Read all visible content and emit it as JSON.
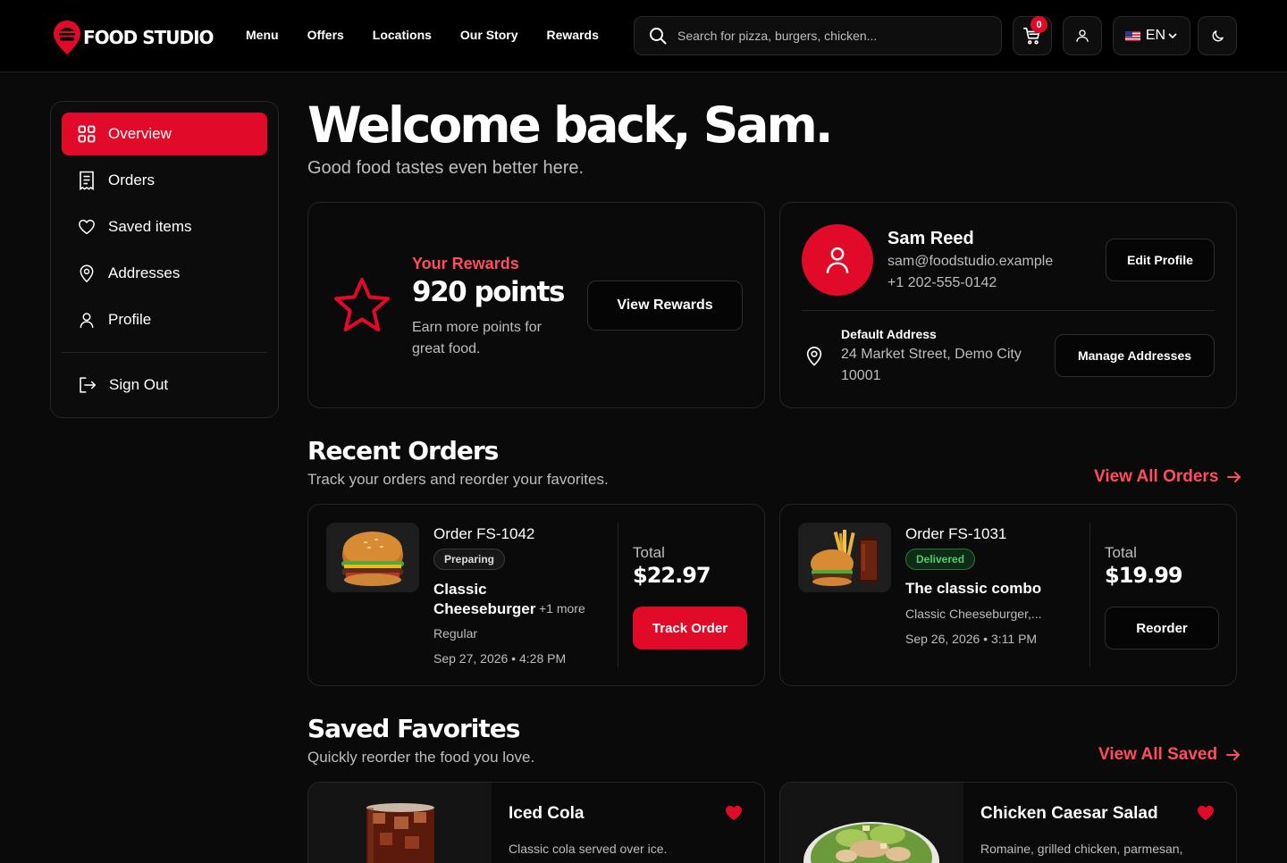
{
  "brand": {
    "name": "FOOD STUDIO",
    "accent": "#e10a28"
  },
  "nav": [
    "Menu",
    "Offers",
    "Locations",
    "Our Story",
    "Rewards"
  ],
  "search": {
    "placeholder": "Search for pizza, burgers, chicken..."
  },
  "cart": {
    "count": "0"
  },
  "language": {
    "code": "EN"
  },
  "sidebar": {
    "items": [
      {
        "label": "Overview",
        "icon": "grid-icon",
        "active": true
      },
      {
        "label": "Orders",
        "icon": "receipt-icon"
      },
      {
        "label": "Saved items",
        "icon": "heart-icon"
      },
      {
        "label": "Addresses",
        "icon": "location-pin-icon"
      },
      {
        "label": "Profile",
        "icon": "user-icon"
      }
    ],
    "signout": "Sign Out"
  },
  "welcome": {
    "title": "Welcome back, Sam.",
    "subtitle": "Good food tastes even better here."
  },
  "rewards": {
    "label": "Your Rewards",
    "points": "920 points",
    "desc": "Earn more points for great food.",
    "button": "View Rewards"
  },
  "profile": {
    "name": "Sam Reed",
    "email": "sam@foodstudio.example",
    "phone": "+1 202-555-0142",
    "edit_button": "Edit Profile",
    "address_label": "Default Address",
    "address": "24 Market Street, Demo City 10001",
    "manage_button": "Manage Addresses"
  },
  "recent_orders": {
    "title": "Recent Orders",
    "subtitle": "Track your orders and reorder your favorites.",
    "view_all": "View All Orders",
    "orders": [
      {
        "id": "Order FS-1042",
        "status": "Preparing",
        "item": "Classic Cheeseburger",
        "more": "+1 more",
        "variant": "Regular",
        "date": "Sep 27, 2026 • 4:28 PM",
        "total_label": "Total",
        "total": "$22.97",
        "action": "Track Order"
      },
      {
        "id": "Order FS-1031",
        "status": "Delivered",
        "item": "The classic combo",
        "details": "Classic Cheeseburger,...",
        "date": "Sep 26, 2026 • 3:11 PM",
        "total_label": "Total",
        "total": "$19.99",
        "action": "Reorder"
      }
    ]
  },
  "saved": {
    "title": "Saved Favorites",
    "subtitle": "Quickly reorder the food you love.",
    "view_all": "View All Saved",
    "items": [
      {
        "name": "Iced Cola",
        "desc": "Classic cola served over ice."
      },
      {
        "name": "Chicken Caesar Salad",
        "desc": "Romaine, grilled chicken, parmesan,"
      }
    ]
  }
}
